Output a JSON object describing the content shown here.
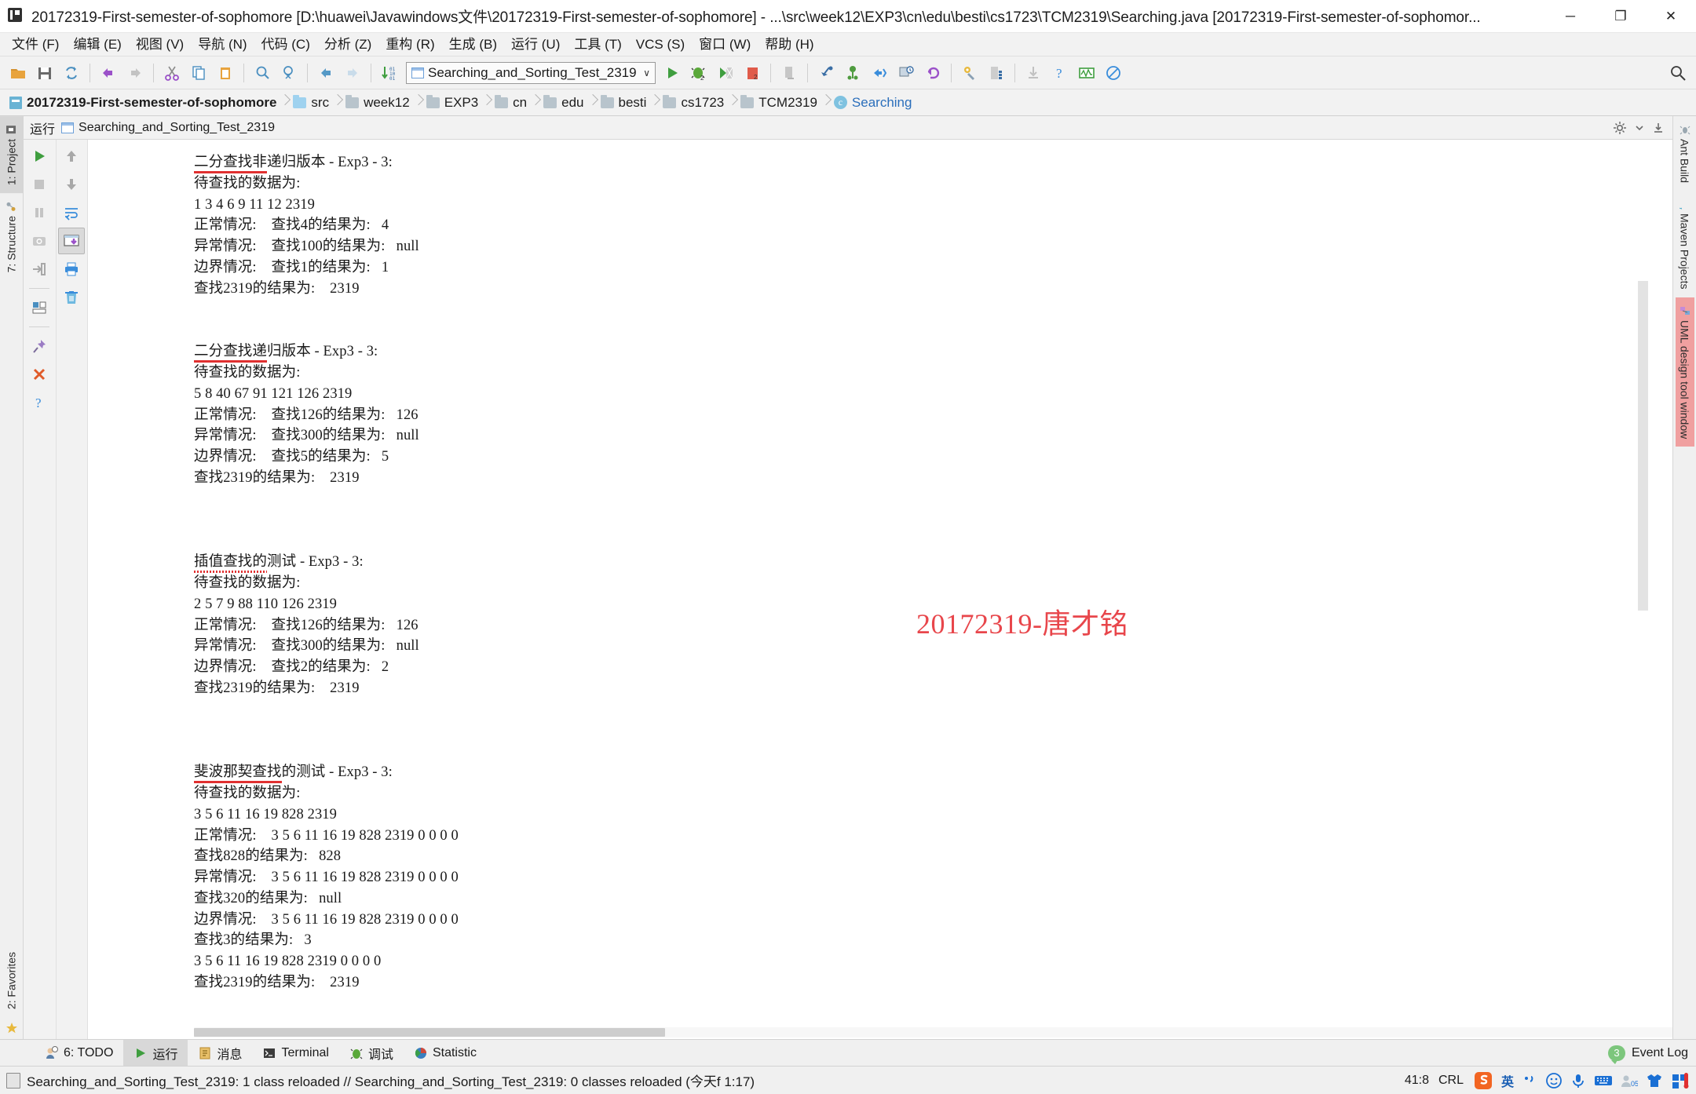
{
  "window": {
    "title": "20172319-First-semester-of-sophomore [D:\\huawei\\Javawindows文件\\20172319-First-semester-of-sophomore] - ...\\src\\week12\\EXP3\\cn\\edu\\besti\\cs1723\\TCM2319\\Searching.java [20172319-First-semester-of-sophomor...",
    "minimize": "─",
    "maximize": "❐",
    "close": "✕"
  },
  "menubar": {
    "items": [
      {
        "label": "文件 (F)"
      },
      {
        "label": "编辑 (E)"
      },
      {
        "label": "视图 (V)"
      },
      {
        "label": "导航 (N)"
      },
      {
        "label": "代码 (C)"
      },
      {
        "label": "分析 (Z)"
      },
      {
        "label": "重构 (R)"
      },
      {
        "label": "生成 (B)"
      },
      {
        "label": "运行 (U)"
      },
      {
        "label": "工具 (T)"
      },
      {
        "label": "VCS (S)"
      },
      {
        "label": "窗口 (W)"
      },
      {
        "label": "帮助 (H)"
      }
    ]
  },
  "toolbar": {
    "run_configuration": "Searching_and_Sorting_Test_2319",
    "chevron": "∨",
    "icons": [
      "open-folder-icon",
      "save-all-icon",
      "sync-icon",
      "undo-icon",
      "redo-icon",
      "cut-icon",
      "copy-icon",
      "paste-icon",
      "find-icon",
      "replace-icon",
      "back-icon",
      "forward-icon",
      "compile-icon"
    ],
    "right_icons": [
      "run-icon",
      "debug-icon",
      "run-coverage-icon",
      "stop-icon",
      "update-app-icon",
      "step-into-icon",
      "toggle-bookmark-icon",
      "step-out-icon",
      "sync-remote-icon",
      "revert-icon",
      "settings-icon",
      "project-structure-icon",
      "download-icon",
      "help-icon",
      "profiler-icon",
      "no-access-icon"
    ]
  },
  "breadcrumb": {
    "items": [
      {
        "label": "20172319-First-semester-of-sophomore",
        "icon": "project-icon",
        "kind": "root"
      },
      {
        "label": "src",
        "icon": "source-folder-icon",
        "kind": "source"
      },
      {
        "label": "week12",
        "icon": "folder-icon",
        "kind": "folder"
      },
      {
        "label": "EXP3",
        "icon": "folder-icon",
        "kind": "folder"
      },
      {
        "label": "cn",
        "icon": "folder-icon",
        "kind": "folder"
      },
      {
        "label": "edu",
        "icon": "folder-icon",
        "kind": "folder"
      },
      {
        "label": "besti",
        "icon": "folder-icon",
        "kind": "folder"
      },
      {
        "label": "cs1723",
        "icon": "folder-icon",
        "kind": "folder"
      },
      {
        "label": "TCM2319",
        "icon": "folder-icon",
        "kind": "folder"
      },
      {
        "label": "Searching",
        "icon": "class-icon",
        "kind": "leaf"
      }
    ]
  },
  "left_rail": {
    "top_items": [
      {
        "label": "1: Project",
        "icon": "project-tool-icon",
        "active": true
      },
      {
        "label": "7: Structure",
        "icon": "structure-tool-icon",
        "active": false
      }
    ],
    "bottom_items": [
      {
        "label": "2: Favorites",
        "icon": "favorites-star-icon",
        "active": false
      }
    ]
  },
  "right_rail": {
    "items": [
      {
        "label": "Ant Build",
        "icon": "ant-build-icon"
      },
      {
        "label": "Maven Projects",
        "icon": "maven-icon"
      },
      {
        "label": "UML design tool window",
        "icon": "uml-icon"
      }
    ]
  },
  "run_window": {
    "title": "运行",
    "tab_label": "Searching_and_Sorting_Test_2319",
    "settings_icon": "gear-icon",
    "hide_icon": "hide-window-icon",
    "left_tool_buttons": [
      "rerun-icon",
      "stop-icon",
      "pause-icon",
      "camera-icon",
      "enter-icon",
      "layout-icon",
      "pin-tab-icon",
      "close-tab-icon",
      "help-icon"
    ],
    "right_tool_buttons": [
      "scroll-up-icon",
      "scroll-down-icon",
      "soft-wrap-icon",
      "scroll-to-end-icon",
      "print-icon",
      "clear-all-icon"
    ]
  },
  "console": {
    "watermark": "20172319-唐才铭",
    "lines": [
      {
        "text": "二分查找非递归版本 - Exp3 - 3:",
        "underline": "二分查找非",
        "underline_style": "solid"
      },
      {
        "text": "待查找的数据为:"
      },
      {
        "text": "1 3 4 6 9 11 12 2319"
      },
      {
        "text": "正常情况:    查找4的结果为:   4"
      },
      {
        "text": "异常情况:    查找100的结果为:   null"
      },
      {
        "text": "边界情况:    查找1的结果为:   1"
      },
      {
        "text": "查找2319的结果为:    2319"
      },
      {
        "text": ""
      },
      {
        "text": ""
      },
      {
        "text": "二分查找递归版本 - Exp3 - 3:",
        "underline": "二分查找递",
        "underline_style": "solid"
      },
      {
        "text": "待查找的数据为:"
      },
      {
        "text": "5 8 40 67 91 121 126 2319"
      },
      {
        "text": "正常情况:    查找126的结果为:   126"
      },
      {
        "text": "异常情况:    查找300的结果为:   null"
      },
      {
        "text": "边界情况:    查找5的结果为:   5"
      },
      {
        "text": "查找2319的结果为:    2319"
      },
      {
        "text": ""
      },
      {
        "text": ""
      },
      {
        "text": ""
      },
      {
        "text": "插值查找的测试 - Exp3 - 3:",
        "underline": "插值查找的",
        "underline_style": "wavy"
      },
      {
        "text": "待查找的数据为:"
      },
      {
        "text": "2 5 7 9 88 110 126 2319"
      },
      {
        "text": "正常情况:    查找126的结果为:   126"
      },
      {
        "text": "异常情况:    查找300的结果为:   null"
      },
      {
        "text": "边界情况:    查找2的结果为:   2"
      },
      {
        "text": "查找2319的结果为:    2319"
      },
      {
        "text": ""
      },
      {
        "text": ""
      },
      {
        "text": ""
      },
      {
        "text": "斐波那契查找的测试 - Exp3 - 3:",
        "underline": "斐波那契查找",
        "underline_style": "solid"
      },
      {
        "text": "待查找的数据为:"
      },
      {
        "text": "3 5 6 11 16 19 828 2319"
      },
      {
        "text": "正常情况:    3 5 6 11 16 19 828 2319 0 0 0 0"
      },
      {
        "text": "查找828的结果为:   828"
      },
      {
        "text": "异常情况:    3 5 6 11 16 19 828 2319 0 0 0 0"
      },
      {
        "text": "查找320的结果为:   null"
      },
      {
        "text": "边界情况:    3 5 6 11 16 19 828 2319 0 0 0 0"
      },
      {
        "text": "查找3的结果为:   3"
      },
      {
        "text": "3 5 6 11 16 19 828 2319 0 0 0 0"
      },
      {
        "text": "查找2319的结果为:    2319"
      }
    ]
  },
  "bottom_tabs": {
    "items": [
      {
        "label": "6: TODO",
        "icon": "todo-icon",
        "active": false
      },
      {
        "label": "运行",
        "icon": "run-green-icon",
        "active": true
      },
      {
        "label": "消息",
        "icon": "messages-icon",
        "active": false
      },
      {
        "label": "Terminal",
        "icon": "terminal-icon",
        "active": false
      },
      {
        "label": "调试",
        "icon": "debug-bug-icon",
        "active": false
      },
      {
        "label": "Statistic",
        "icon": "statistic-icon",
        "active": false
      }
    ],
    "event_log": {
      "label": "Event Log",
      "count": "3"
    }
  },
  "statusbar": {
    "message": "Searching_and_Sorting_Test_2319: 1 class reloaded // Searching_and_Sorting_Test_2319: 0 classes reloaded (今天f 1:17)",
    "caret_position": "41:8",
    "line_separator": "CRL",
    "tray": {
      "ime_logo": "sogou-s-icon",
      "ime_mode": "英",
      "punctuation": "punctuation-icon",
      "emoji": "emoji-icon",
      "voice": "microphone-icon",
      "keyboard": "soft-keyboard-icon",
      "user": "account-icon",
      "skin": "skin-shirt-icon",
      "toolbox": "toolbox-icon"
    }
  },
  "colors": {
    "accent_blue": "#2a6ebb",
    "watermark_red": "#e8464b",
    "underline_red": "#e03030",
    "green_run": "#3f9e3f",
    "chrome": "#f0f0f0"
  }
}
